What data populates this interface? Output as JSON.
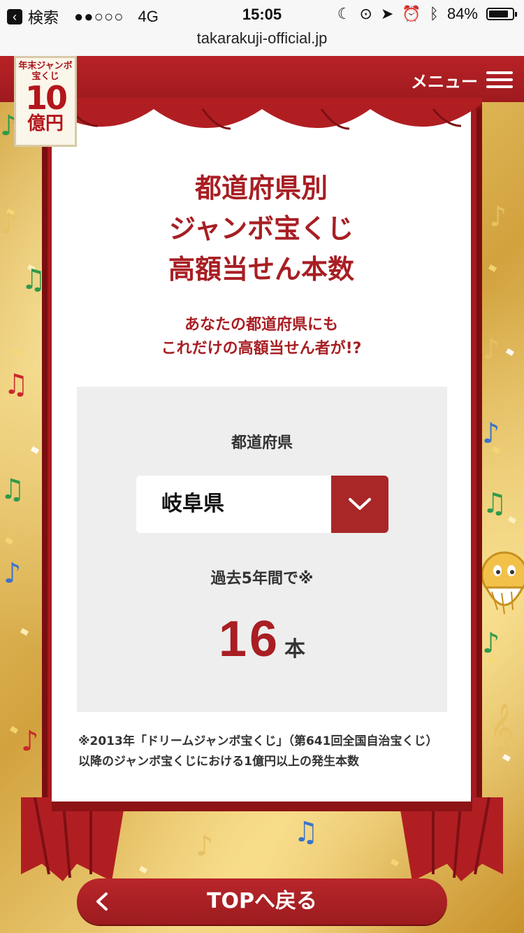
{
  "status_bar": {
    "back_app": "検索",
    "signal": "●●○○○",
    "network": "4G",
    "time": "15:05",
    "battery": "84%",
    "battery_level": 0.84
  },
  "browser": {
    "url": "takarakuji-official.jp"
  },
  "header": {
    "menu_label": "メニュー",
    "logo": {
      "top_text": "年末ジャンボ宝くじ",
      "amount_number": "10",
      "amount_unit": "億円"
    }
  },
  "page": {
    "title_lines": [
      "都道府県別",
      "ジャンボ宝くじ",
      "高額当せん本数"
    ],
    "subtitle_lines": [
      "あなたの都道府県にも",
      "これだけの高額当せん者が!?"
    ],
    "prefecture_label": "都道府県",
    "prefecture_selected": "岐阜県",
    "period_text": "過去5年間で※",
    "count_value": "16",
    "count_unit": "本",
    "footnote": "※2013年「ドリームジャンボ宝くじ」（第641回全国自治宝くじ）以降のジャンボ宝くじにおける1億円以上の発生本数"
  },
  "nav": {
    "top_button_label": "TOPへ戻る"
  },
  "colors": {
    "brand_red": "#a81e23",
    "panel_bg": "#eeeeee",
    "gold": "#e0b757"
  },
  "icons": {
    "menu": "hamburger-icon",
    "select": "chevron-down-icon",
    "back": "chevron-left-icon"
  }
}
